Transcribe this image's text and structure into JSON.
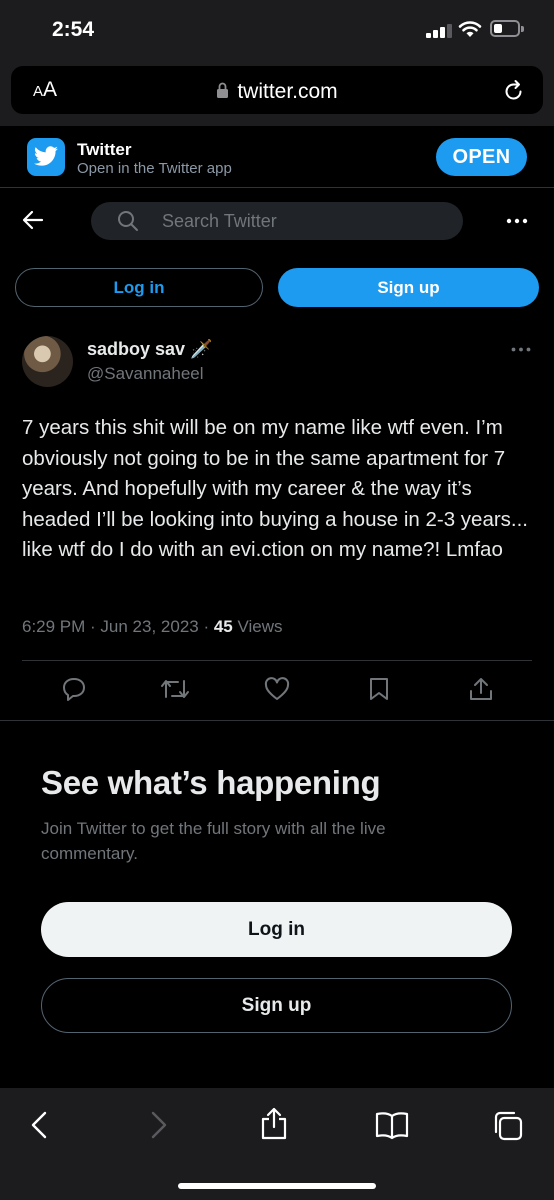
{
  "status": {
    "time": "2:54"
  },
  "browser": {
    "text_size_label_small": "A",
    "text_size_label_large": "A",
    "url": "twitter.com"
  },
  "banner": {
    "app_name": "Twitter",
    "subtitle": "Open in the Twitter app",
    "open_label": "OPEN"
  },
  "nav": {
    "search_placeholder": "Search Twitter"
  },
  "top_buttons": {
    "login": "Log in",
    "signup": "Sign up"
  },
  "tweet": {
    "name": "sadboy sav",
    "name_emoji": "🗡️",
    "handle": "@Savannaheel",
    "text": "7 years this shit will be on my name like wtf even. I’m obviously not going to be in the same apartment for 7 years. And hopefully with my career & the way it’s headed I’ll be looking into buying a house in 2-3 years... like wtf do I do with an evi.ction on my name?! Lmfao",
    "time": "6:29 PM",
    "date": "Jun 23, 2023",
    "views_count": "45",
    "views_label": "Views"
  },
  "cta": {
    "title": "See what’s happening",
    "subtitle": "Join Twitter to get the full story with all the live commentary.",
    "login": "Log in",
    "signup": "Sign up"
  },
  "colors": {
    "accent": "#1d9bf0",
    "background": "#000000",
    "text": "#e7e9ea",
    "muted": "#71767b"
  }
}
